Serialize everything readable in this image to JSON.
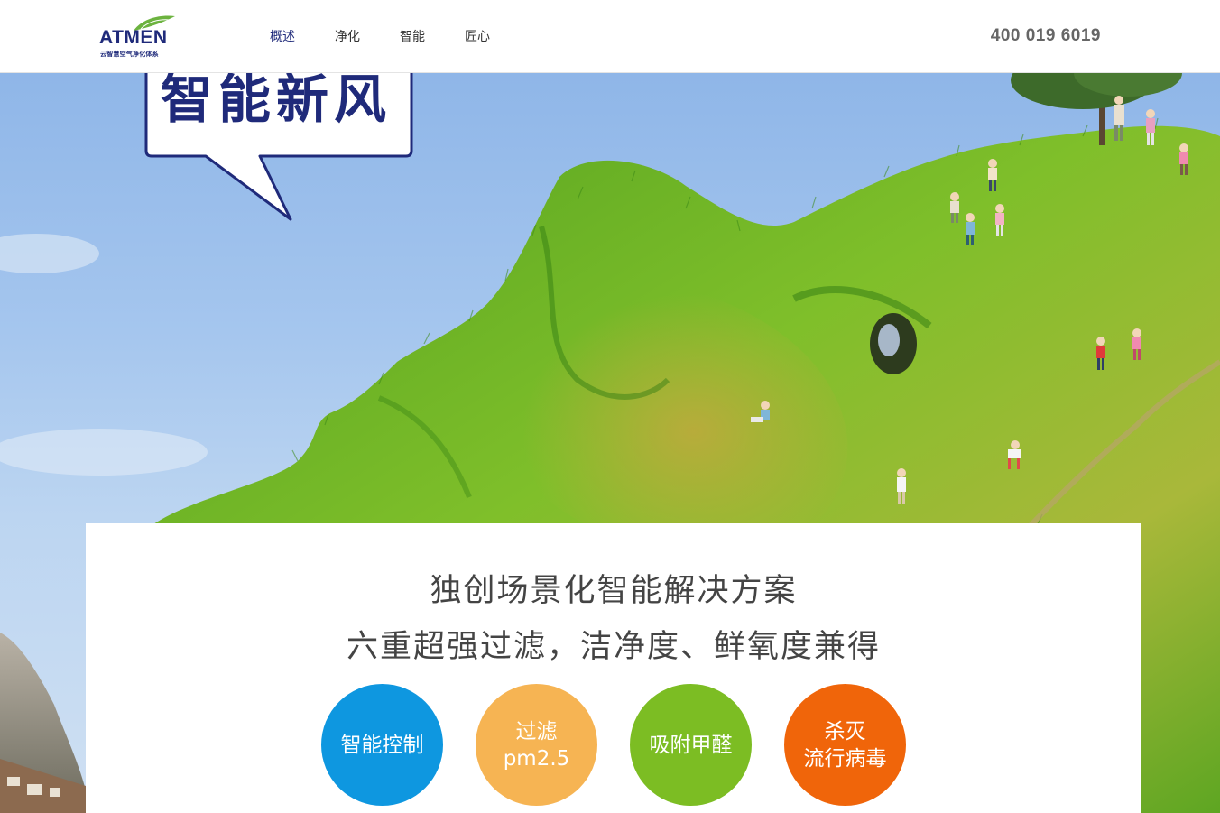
{
  "header": {
    "logo": {
      "brand": "ATMEN",
      "tagline": "云智慧空气净化体系"
    },
    "nav": [
      "概述",
      "净化",
      "智能",
      "匠心"
    ],
    "active_nav": "概述",
    "phone": "400 019 6019"
  },
  "hero": {
    "bubble_text": "智能新风"
  },
  "content": {
    "line1": "独创场景化智能解决方案",
    "line2": "六重超强过滤，洁净度、鲜氧度兼得",
    "features": [
      {
        "line1": "智能控制",
        "line2": "",
        "color": "#0e97e0"
      },
      {
        "line1": "过滤",
        "line2": "pm2.5",
        "color": "#f6b453"
      },
      {
        "line1": "吸附甲醛",
        "line2": "",
        "color": "#7cbd23"
      },
      {
        "line1": "杀灭",
        "line2": "流行病毒",
        "color": "#f0650a"
      }
    ]
  },
  "colors": {
    "brand": "#1f2a7a",
    "sky": "#a5c6ee",
    "grass": "#5fb02a"
  }
}
